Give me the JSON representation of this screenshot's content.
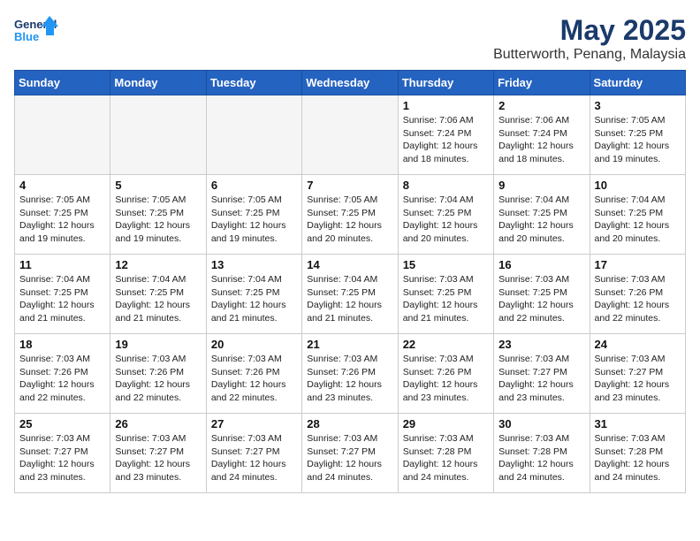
{
  "logo": {
    "line1": "General",
    "line2": "Blue"
  },
  "title": "May 2025",
  "subtitle": "Butterworth, Penang, Malaysia",
  "weekdays": [
    "Sunday",
    "Monday",
    "Tuesday",
    "Wednesday",
    "Thursday",
    "Friday",
    "Saturday"
  ],
  "weeks": [
    [
      {
        "day": "",
        "info": ""
      },
      {
        "day": "",
        "info": ""
      },
      {
        "day": "",
        "info": ""
      },
      {
        "day": "",
        "info": ""
      },
      {
        "day": "1",
        "info": "Sunrise: 7:06 AM\nSunset: 7:24 PM\nDaylight: 12 hours\nand 18 minutes."
      },
      {
        "day": "2",
        "info": "Sunrise: 7:06 AM\nSunset: 7:24 PM\nDaylight: 12 hours\nand 18 minutes."
      },
      {
        "day": "3",
        "info": "Sunrise: 7:05 AM\nSunset: 7:25 PM\nDaylight: 12 hours\nand 19 minutes."
      }
    ],
    [
      {
        "day": "4",
        "info": "Sunrise: 7:05 AM\nSunset: 7:25 PM\nDaylight: 12 hours\nand 19 minutes."
      },
      {
        "day": "5",
        "info": "Sunrise: 7:05 AM\nSunset: 7:25 PM\nDaylight: 12 hours\nand 19 minutes."
      },
      {
        "day": "6",
        "info": "Sunrise: 7:05 AM\nSunset: 7:25 PM\nDaylight: 12 hours\nand 19 minutes."
      },
      {
        "day": "7",
        "info": "Sunrise: 7:05 AM\nSunset: 7:25 PM\nDaylight: 12 hours\nand 20 minutes."
      },
      {
        "day": "8",
        "info": "Sunrise: 7:04 AM\nSunset: 7:25 PM\nDaylight: 12 hours\nand 20 minutes."
      },
      {
        "day": "9",
        "info": "Sunrise: 7:04 AM\nSunset: 7:25 PM\nDaylight: 12 hours\nand 20 minutes."
      },
      {
        "day": "10",
        "info": "Sunrise: 7:04 AM\nSunset: 7:25 PM\nDaylight: 12 hours\nand 20 minutes."
      }
    ],
    [
      {
        "day": "11",
        "info": "Sunrise: 7:04 AM\nSunset: 7:25 PM\nDaylight: 12 hours\nand 21 minutes."
      },
      {
        "day": "12",
        "info": "Sunrise: 7:04 AM\nSunset: 7:25 PM\nDaylight: 12 hours\nand 21 minutes."
      },
      {
        "day": "13",
        "info": "Sunrise: 7:04 AM\nSunset: 7:25 PM\nDaylight: 12 hours\nand 21 minutes."
      },
      {
        "day": "14",
        "info": "Sunrise: 7:04 AM\nSunset: 7:25 PM\nDaylight: 12 hours\nand 21 minutes."
      },
      {
        "day": "15",
        "info": "Sunrise: 7:03 AM\nSunset: 7:25 PM\nDaylight: 12 hours\nand 21 minutes."
      },
      {
        "day": "16",
        "info": "Sunrise: 7:03 AM\nSunset: 7:25 PM\nDaylight: 12 hours\nand 22 minutes."
      },
      {
        "day": "17",
        "info": "Sunrise: 7:03 AM\nSunset: 7:26 PM\nDaylight: 12 hours\nand 22 minutes."
      }
    ],
    [
      {
        "day": "18",
        "info": "Sunrise: 7:03 AM\nSunset: 7:26 PM\nDaylight: 12 hours\nand 22 minutes."
      },
      {
        "day": "19",
        "info": "Sunrise: 7:03 AM\nSunset: 7:26 PM\nDaylight: 12 hours\nand 22 minutes."
      },
      {
        "day": "20",
        "info": "Sunrise: 7:03 AM\nSunset: 7:26 PM\nDaylight: 12 hours\nand 22 minutes."
      },
      {
        "day": "21",
        "info": "Sunrise: 7:03 AM\nSunset: 7:26 PM\nDaylight: 12 hours\nand 23 minutes."
      },
      {
        "day": "22",
        "info": "Sunrise: 7:03 AM\nSunset: 7:26 PM\nDaylight: 12 hours\nand 23 minutes."
      },
      {
        "day": "23",
        "info": "Sunrise: 7:03 AM\nSunset: 7:27 PM\nDaylight: 12 hours\nand 23 minutes."
      },
      {
        "day": "24",
        "info": "Sunrise: 7:03 AM\nSunset: 7:27 PM\nDaylight: 12 hours\nand 23 minutes."
      }
    ],
    [
      {
        "day": "25",
        "info": "Sunrise: 7:03 AM\nSunset: 7:27 PM\nDaylight: 12 hours\nand 23 minutes."
      },
      {
        "day": "26",
        "info": "Sunrise: 7:03 AM\nSunset: 7:27 PM\nDaylight: 12 hours\nand 23 minutes."
      },
      {
        "day": "27",
        "info": "Sunrise: 7:03 AM\nSunset: 7:27 PM\nDaylight: 12 hours\nand 24 minutes."
      },
      {
        "day": "28",
        "info": "Sunrise: 7:03 AM\nSunset: 7:27 PM\nDaylight: 12 hours\nand 24 minutes."
      },
      {
        "day": "29",
        "info": "Sunrise: 7:03 AM\nSunset: 7:28 PM\nDaylight: 12 hours\nand 24 minutes."
      },
      {
        "day": "30",
        "info": "Sunrise: 7:03 AM\nSunset: 7:28 PM\nDaylight: 12 hours\nand 24 minutes."
      },
      {
        "day": "31",
        "info": "Sunrise: 7:03 AM\nSunset: 7:28 PM\nDaylight: 12 hours\nand 24 minutes."
      }
    ]
  ]
}
